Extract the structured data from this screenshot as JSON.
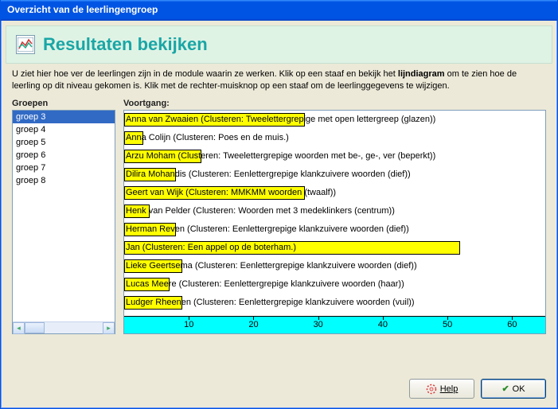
{
  "window": {
    "title": "Overzicht van de leerlingengroep"
  },
  "header": {
    "title": "Resultaten bekijken"
  },
  "intro": {
    "part1": "U ziet hier hoe ver de leerlingen zijn in de module waarin ze werken. Klik op een staaf en bekijk het ",
    "bold": "lijndiagram",
    "part2": " om te zien hoe de leerling op dit niveau gekomen is. Klik met de rechter-muisknop op een staaf om de leerlinggegevens te wijzigen."
  },
  "labels": {
    "groups": "Groepen",
    "progress": "Voortgang:"
  },
  "groups": [
    {
      "name": "groep 3",
      "selected": true
    },
    {
      "name": "groep 4",
      "selected": false
    },
    {
      "name": "groep 5",
      "selected": false
    },
    {
      "name": "groep 6",
      "selected": false
    },
    {
      "name": "groep 7",
      "selected": false
    },
    {
      "name": "groep 8",
      "selected": false
    }
  ],
  "chart_data": {
    "type": "bar",
    "orientation": "horizontal",
    "xlabel": "",
    "ylabel": "",
    "xlim": [
      0,
      65
    ],
    "ticks": [
      10,
      20,
      30,
      40,
      50,
      60
    ],
    "bar_color": "#ffff00",
    "axis_color": "#00ffff",
    "series": [
      {
        "name": "Anna van Zwaaien",
        "label": "Anna van Zwaaien  (Clusteren: Tweelettergrepige met open lettergreep (glazen))",
        "value": 28
      },
      {
        "name": "Anna Colijn",
        "label": "Anna Colijn  (Clusteren: Poes en de muis.)",
        "value": 3
      },
      {
        "name": "Arzu Moham",
        "label": "Arzu Moham  (Clusteren: Tweelettergrepige woorden met be-, ge-, ver (beperkt))",
        "value": 12
      },
      {
        "name": "Dilira Mohandis",
        "label": "Dilira Mohandis (Clusteren: Eenlettergrepige klankzuivere woorden (dief))",
        "value": 8
      },
      {
        "name": "Geert van Wijk",
        "label": "Geert van Wijk  (Clusteren: MMKMM woorden (twaalf))",
        "value": 28
      },
      {
        "name": "Henk van Pelder",
        "label": "Henk van Pelder  (Clusteren: Woorden met 3 medeklinkers (centrum))",
        "value": 4
      },
      {
        "name": "Herman Reven",
        "label": "Herman Reven (Clusteren: Eenlettergrepige klankzuivere woorden (dief))",
        "value": 8
      },
      {
        "name": "Jan",
        "label": "Jan   (Clusteren: Een appel op de boterham.)",
        "value": 52
      },
      {
        "name": "Lieke Geertsema",
        "label": "Lieke Geertsema  (Clusteren: Eenlettergrepige klankzuivere woorden (dief))",
        "value": 9
      },
      {
        "name": "Lucas Meere",
        "label": "Lucas Meere (Clusteren: Eenlettergrepige klankzuivere woorden (haar))",
        "value": 7
      },
      {
        "name": "Ludger Rheenen",
        "label": "Ludger Rheenen (Clusteren: Eenlettergrepige klankzuivere woorden (vuil))",
        "value": 9
      }
    ]
  },
  "buttons": {
    "help": "Help",
    "ok": "OK"
  }
}
